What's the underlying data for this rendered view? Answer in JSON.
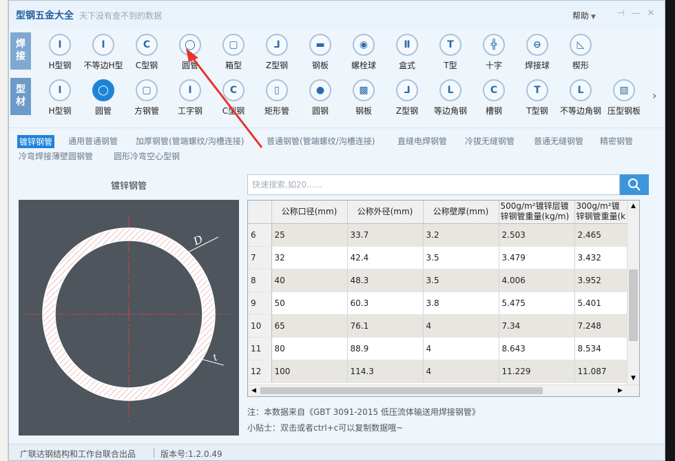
{
  "window": {
    "title": "型钢五金大全",
    "slogan": "天下没有查不到的数据",
    "help_label": "帮助",
    "controls": [
      "pin-icon",
      "minimize-icon",
      "close-icon"
    ]
  },
  "categories": {
    "weld": {
      "label_1": "焊",
      "label_2": "接"
    },
    "profile": {
      "label_1": "型",
      "label_2": "材"
    }
  },
  "weld_items": [
    {
      "label": "H型钢",
      "icon": "Ⅰ"
    },
    {
      "label": "不等边H型",
      "icon": "Ⅰ"
    },
    {
      "label": "C型钢",
      "icon": "Ⅽ"
    },
    {
      "label": "圆管",
      "icon": "◯"
    },
    {
      "label": "箱型",
      "icon": "▢"
    },
    {
      "label": "Z型钢",
      "icon": "⅃"
    },
    {
      "label": "钢板",
      "icon": "▬"
    },
    {
      "label": "螺栓球",
      "icon": "◉"
    },
    {
      "label": "盒式",
      "icon": "Ⅱ"
    },
    {
      "label": "T型",
      "icon": "T"
    },
    {
      "label": "十字",
      "icon": "╬"
    },
    {
      "label": "焊接球",
      "icon": "⊖"
    },
    {
      "label": "楔形",
      "icon": "◺"
    }
  ],
  "profile_items": [
    {
      "label": "H型钢",
      "icon": "Ⅰ"
    },
    {
      "label": "圆管",
      "icon": "◯"
    },
    {
      "label": "方钢管",
      "icon": "▢"
    },
    {
      "label": "工字钢",
      "icon": "Ⅰ"
    },
    {
      "label": "C型钢",
      "icon": "Ⅽ"
    },
    {
      "label": "矩形管",
      "icon": "▯"
    },
    {
      "label": "圆钢",
      "icon": "●"
    },
    {
      "label": "钢板",
      "icon": "▩"
    },
    {
      "label": "Z型钢",
      "icon": "⅃"
    },
    {
      "label": "等边角钢",
      "icon": "L"
    },
    {
      "label": "槽钢",
      "icon": "Ⅽ"
    },
    {
      "label": "T型钢",
      "icon": "T"
    },
    {
      "label": "不等边角钢",
      "icon": "L"
    },
    {
      "label": "压型钢板",
      "icon": "▧"
    }
  ],
  "subtypes": [
    "镀锌钢管",
    "通用普通钢管",
    "加厚钢管(管端螺纹/沟槽连接)",
    "普通钢管(管端螺纹/沟槽连接)",
    "直缝电焊钢管",
    "冷拔无缝钢管",
    "普通无缝钢管",
    "精密钢管",
    "冷弯焊接薄壁圆钢管",
    "圆形冷弯空心型钢"
  ],
  "panel_title": "镀锌钢管",
  "drawing": {
    "label_d": "D",
    "label_t": "t"
  },
  "search": {
    "placeholder": "快速搜索,如20......"
  },
  "table": {
    "columns": [
      "公称口径(mm)",
      "公称外径(mm)",
      "公称壁厚(mm)",
      "500g/m²镀锌层镀锌钢管重量(kg/m)",
      "300g/m²镀锌钢管重量(k"
    ],
    "rows": [
      {
        "no": "6",
        "cells": [
          "25",
          "33.7",
          "3.2",
          "2.503",
          "2.465"
        ]
      },
      {
        "no": "7",
        "cells": [
          "32",
          "42.4",
          "3.5",
          "3.479",
          "3.432"
        ]
      },
      {
        "no": "8",
        "cells": [
          "40",
          "48.3",
          "3.5",
          "4.006",
          "3.952"
        ]
      },
      {
        "no": "9",
        "cells": [
          "50",
          "60.3",
          "3.8",
          "5.475",
          "5.401"
        ]
      },
      {
        "no": "10",
        "cells": [
          "65",
          "76.1",
          "4",
          "7.34",
          "7.248"
        ]
      },
      {
        "no": "11",
        "cells": [
          "80",
          "88.9",
          "4",
          "8.643",
          "8.534"
        ]
      },
      {
        "no": "12",
        "cells": [
          "100",
          "114.3",
          "4",
          "11.229",
          "11.087"
        ]
      }
    ]
  },
  "note": "注：本数据来自《GBT 3091-2015 低压流体输送用焊接钢管》",
  "tip": "小贴士：双击或者ctrl+c可以复制数据哦~",
  "footer": {
    "credit": "广联达钢结构和工作台联合出品",
    "version": "版本号:1.2.0.49"
  },
  "colors": {
    "accent": "#1e84d8",
    "drawing_bg": "#4f555d",
    "annotation_arrow": "#e8322a"
  }
}
